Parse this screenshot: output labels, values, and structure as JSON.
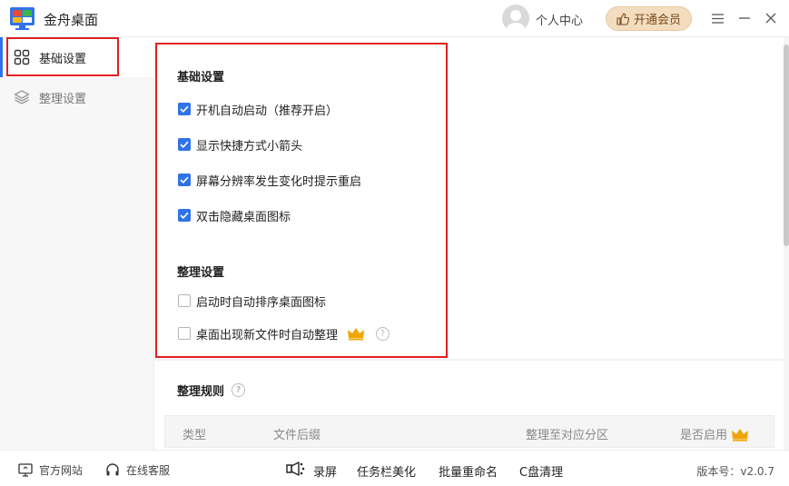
{
  "app": {
    "title": "金舟桌面"
  },
  "header": {
    "user_center": "个人中心",
    "vip_label": "开通会员"
  },
  "sidebar": {
    "items": [
      {
        "label": "基础设置",
        "active": true
      },
      {
        "label": "整理设置",
        "active": false
      }
    ]
  },
  "basic": {
    "title": "基础设置",
    "options": [
      {
        "label": "开机自动启动（推荐开启）",
        "checked": true
      },
      {
        "label": "显示快捷方式小箭头",
        "checked": true
      },
      {
        "label": "屏幕分辨率发生变化时提示重启",
        "checked": true
      },
      {
        "label": "双击隐藏桌面图标",
        "checked": true
      }
    ]
  },
  "organize": {
    "title": "整理设置",
    "options": [
      {
        "label": "启动时自动排序桌面图标",
        "checked": false
      },
      {
        "label": "桌面出现新文件时自动整理",
        "checked": false
      }
    ]
  },
  "rules": {
    "title": "整理规则",
    "columns": [
      "类型",
      "文件后缀",
      "整理至对应分区",
      "是否启用"
    ]
  },
  "footer": {
    "website": "官方网站",
    "support": "在线客服",
    "tools": [
      "录屏",
      "任务栏美化",
      "批量重命名",
      "C盘清理"
    ],
    "version": "版本号：v2.0.7"
  },
  "colors": {
    "accent": "#2f73e8",
    "highlight_box": "#e02020",
    "vip_bg": "#f3dcc0",
    "crown": "#f0a500"
  }
}
